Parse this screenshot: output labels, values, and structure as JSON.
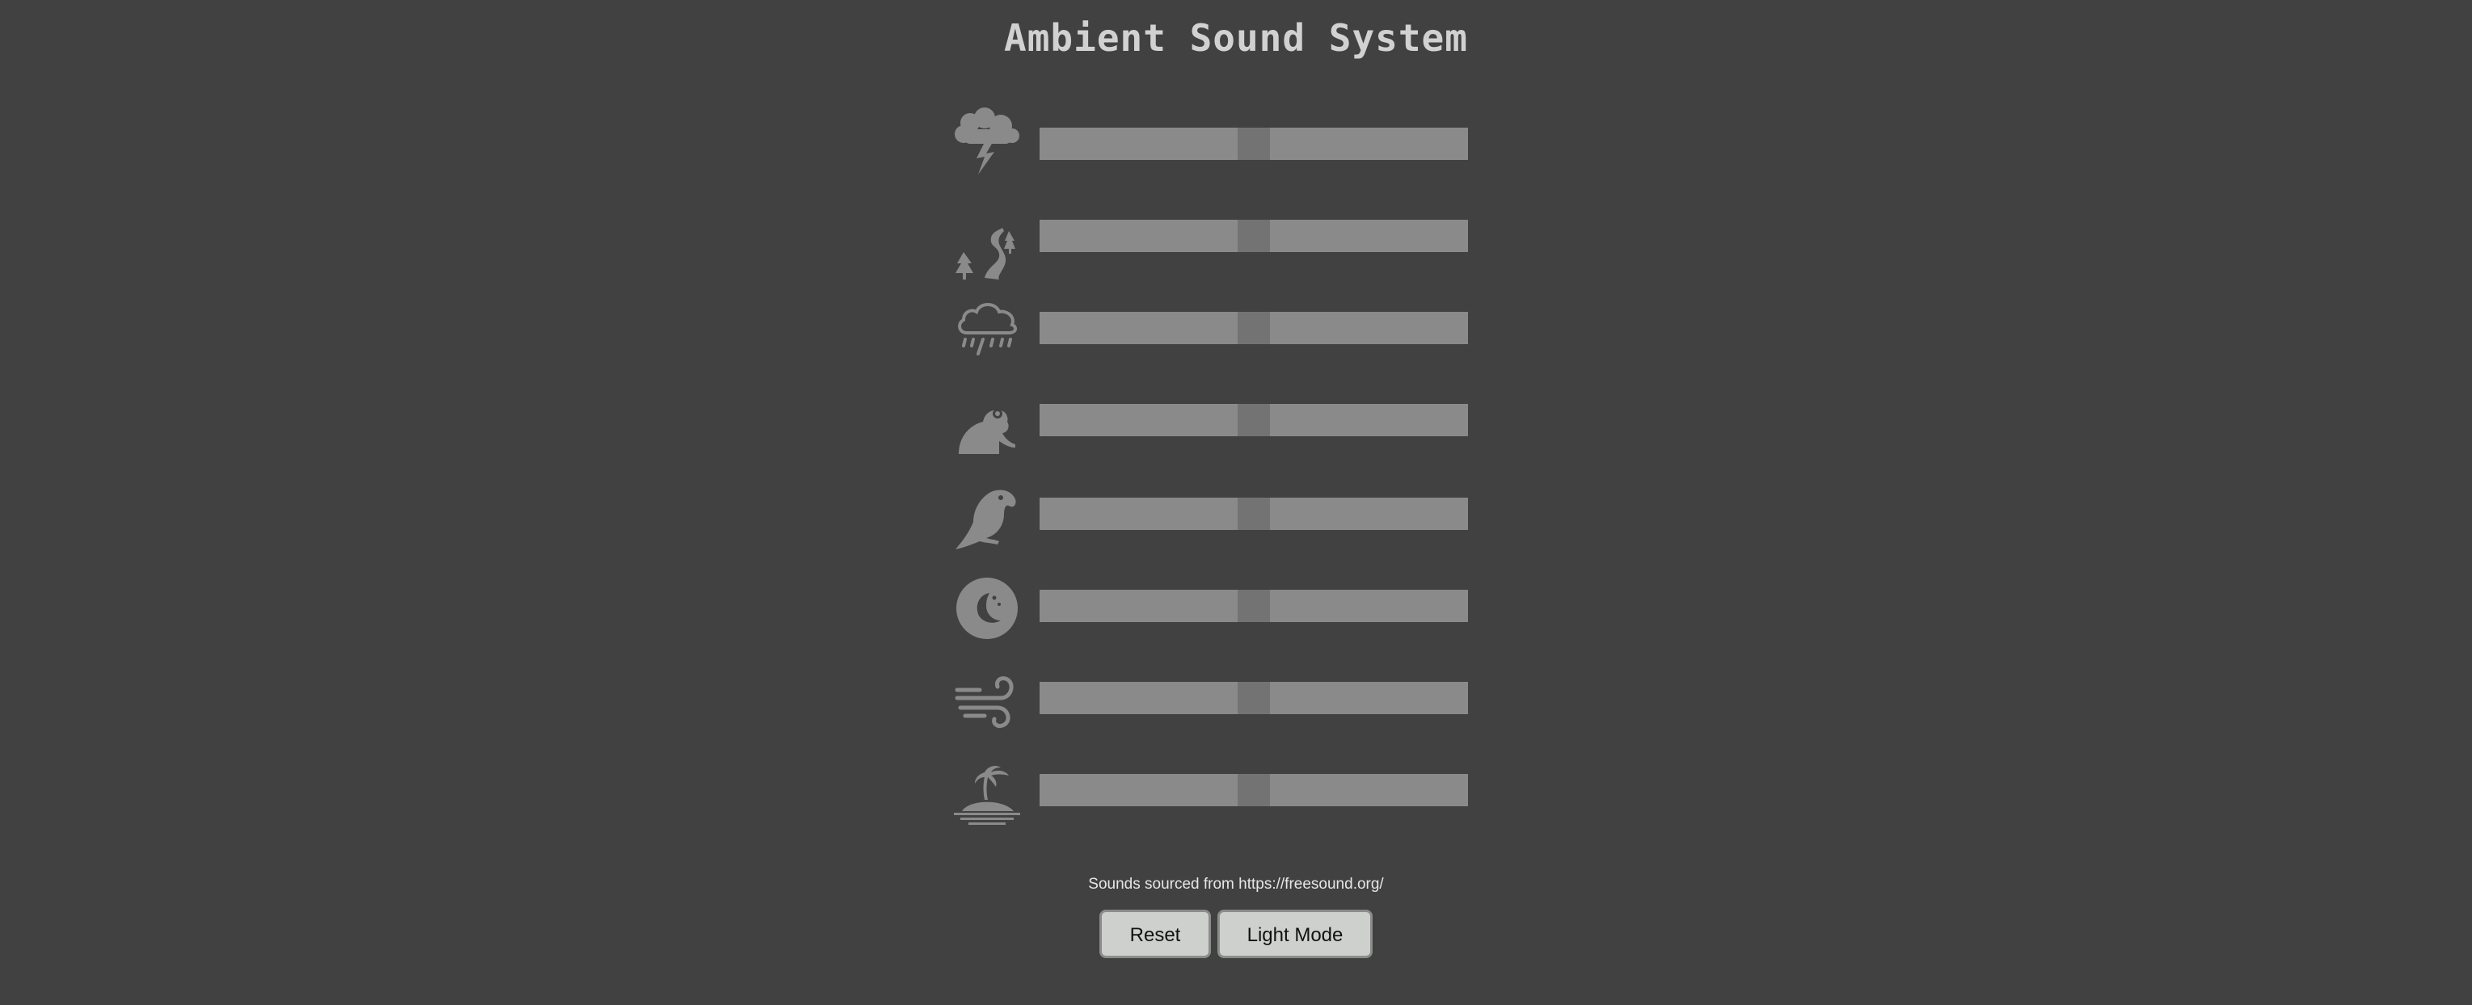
{
  "header": {
    "title": "Ambient Sound System"
  },
  "sounds": [
    {
      "icon": "thunderstorm-icon",
      "volume": 0.5
    },
    {
      "icon": "river-icon",
      "volume": 0.5
    },
    {
      "icon": "rain-cloud-icon",
      "volume": 0.5
    },
    {
      "icon": "frog-icon",
      "volume": 0.5
    },
    {
      "icon": "parrot-icon",
      "volume": 0.5
    },
    {
      "icon": "night-moon-icon",
      "volume": 0.5
    },
    {
      "icon": "wind-icon",
      "volume": 0.5
    },
    {
      "icon": "island-waves-icon",
      "volume": 0.5
    }
  ],
  "footer": {
    "credit": "Sounds sourced from https://freesound.org/",
    "reset_label": "Reset",
    "mode_label": "Light Mode"
  },
  "colors": {
    "background": "#414141",
    "slider_track": "#8a8a8a",
    "slider_thumb": "#737373",
    "icon": "#8c8c8c",
    "button_bg": "#cdd0cd"
  }
}
